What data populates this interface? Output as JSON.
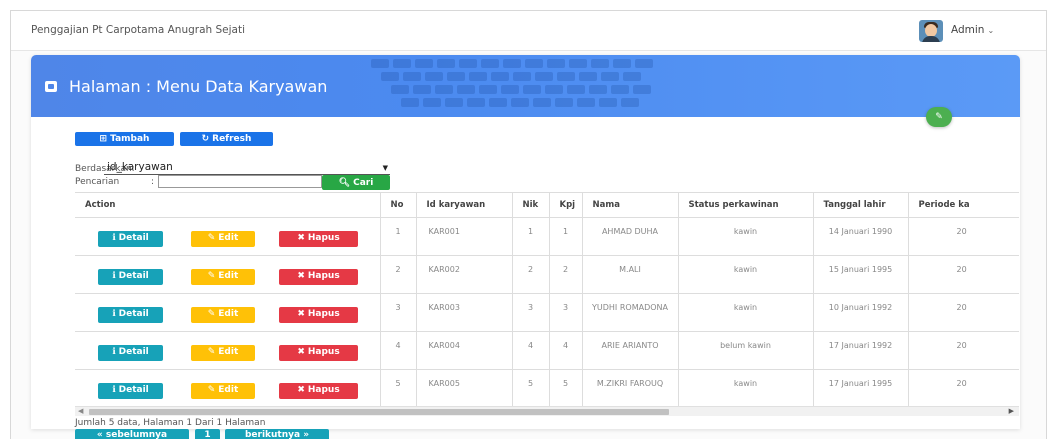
{
  "app": {
    "title": "Penggajian Pt Carpotama Anugrah Sejati"
  },
  "user": {
    "name": "Admin",
    "caret": "⌄"
  },
  "page": {
    "heading": "Halaman : Menu Data Karyawan"
  },
  "toolbar": {
    "add_label": "Tambah",
    "refresh_label": "Refresh"
  },
  "filter": {
    "by_label": "Berdasarkan:",
    "by_value": "id_karyawan",
    "search_label": "Pencarian",
    "search_colon": ":",
    "search_value": "",
    "search_button": "Cari"
  },
  "table": {
    "headers": [
      "Action",
      "No",
      "Id karyawan",
      "Nik",
      "Kpj",
      "Nama",
      "Status perkawinan",
      "Tanggal lahir",
      "Periode ka"
    ],
    "action_labels": {
      "detail": "Detail",
      "edit": "Edit",
      "delete": "Hapus"
    },
    "rows": [
      {
        "no": "1",
        "id": "KAR001",
        "nik": "1",
        "kpj": "1",
        "nama": "AHMAD DUHA",
        "status": "kawin",
        "tgl": "14 Januari 1990",
        "periode": "20"
      },
      {
        "no": "2",
        "id": "KAR002",
        "nik": "2",
        "kpj": "2",
        "nama": "M.ALI",
        "status": "kawin",
        "tgl": "15 Januari 1995",
        "periode": "20"
      },
      {
        "no": "3",
        "id": "KAR003",
        "nik": "3",
        "kpj": "3",
        "nama": "YUDHI ROMADONA",
        "status": "kawin",
        "tgl": "10 Januari 1992",
        "periode": "20"
      },
      {
        "no": "4",
        "id": "KAR004",
        "nik": "4",
        "kpj": "4",
        "nama": "ARIE ARIANTO",
        "status": "belum kawin",
        "tgl": "17 Januari 1992",
        "periode": "20"
      },
      {
        "no": "5",
        "id": "KAR005",
        "nik": "5",
        "kpj": "5",
        "nama": "M.ZIKRI FAROUQ",
        "status": "kawin",
        "tgl": "17 Januari 1995",
        "periode": "20"
      }
    ]
  },
  "footer": {
    "summary": "Jumlah 5 data, Halaman 1 Dari 1 Halaman",
    "prev": "« sebelumnya",
    "current": "1",
    "next": "berikutnya »"
  },
  "colors": {
    "primary": "#1a73e8",
    "info": "#17a2b8",
    "warning": "#ffc107",
    "danger": "#e53945",
    "success": "#28a745"
  }
}
